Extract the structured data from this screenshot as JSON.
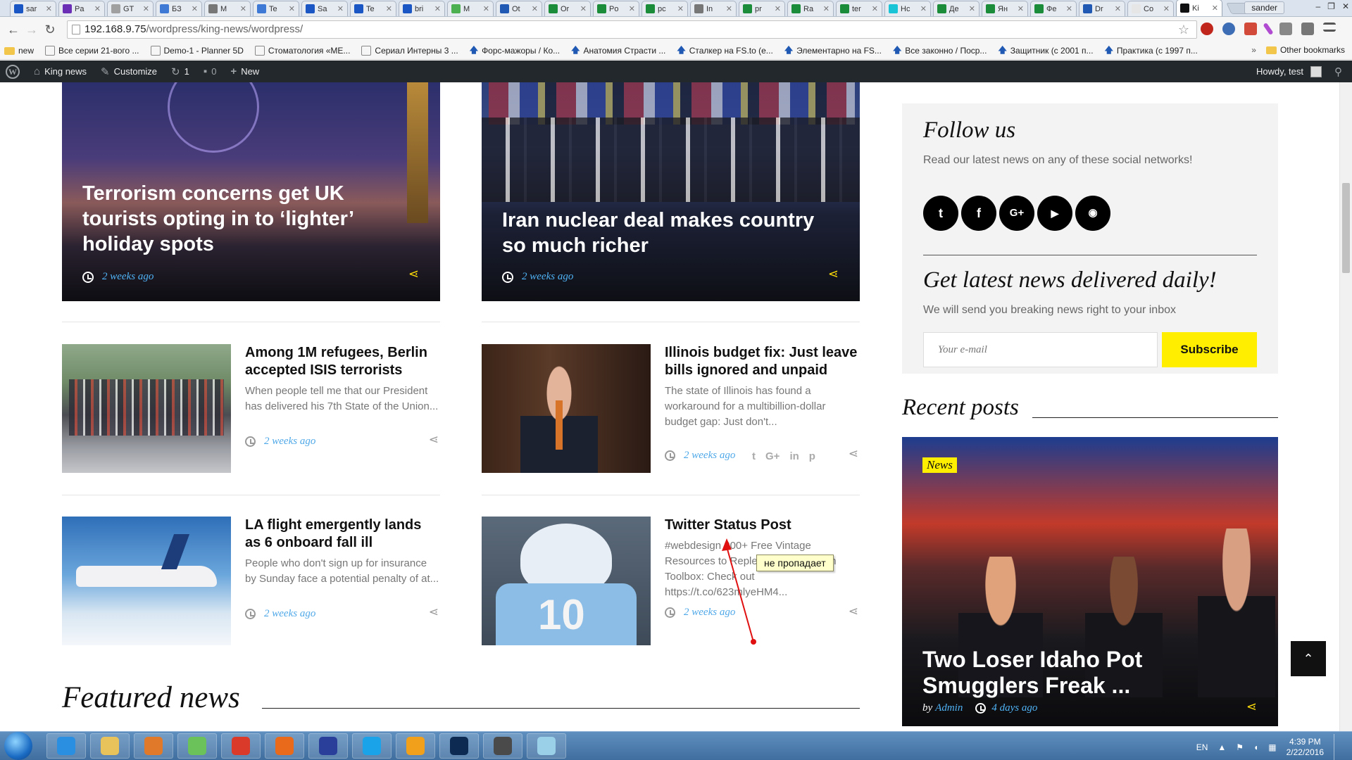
{
  "browser": {
    "tabs": [
      {
        "label": "sar",
        "color": "#1a56c4"
      },
      {
        "label": "Pa",
        "color": "#6b2fb5"
      },
      {
        "label": "GT",
        "color": "#a0a0a0"
      },
      {
        "label": "БЗ",
        "color": "#3e79d6"
      },
      {
        "label": "M",
        "color": "#777777"
      },
      {
        "label": "Te",
        "color": "#3e79d6"
      },
      {
        "label": "Sa",
        "color": "#1a56c4"
      },
      {
        "label": "Te",
        "color": "#1a56c4"
      },
      {
        "label": "bri",
        "color": "#1a56c4"
      },
      {
        "label": "M",
        "color": "#4caf50"
      },
      {
        "label": "Ot",
        "color": "#1f59b3"
      },
      {
        "label": "Or",
        "color": "#1a8c3a"
      },
      {
        "label": "Po",
        "color": "#1a8c3a"
      },
      {
        "label": "pc",
        "color": "#1a8c3a"
      },
      {
        "label": "In",
        "color": "#777777"
      },
      {
        "label": "pr",
        "color": "#1a8c3a"
      },
      {
        "label": "Ra",
        "color": "#1a8c3a"
      },
      {
        "label": "ter",
        "color": "#1a8c3a"
      },
      {
        "label": "Hc",
        "color": "#18c4d6"
      },
      {
        "label": "Де",
        "color": "#1a8c3a"
      },
      {
        "label": "Ян",
        "color": "#1a8c3a"
      },
      {
        "label": "Фе",
        "color": "#1a8c3a"
      },
      {
        "label": "Dr",
        "color": "#1f59b3"
      },
      {
        "label": "Co",
        "color": "#e6e6e6"
      },
      {
        "label": "Ki",
        "color": "#111111",
        "active": true
      }
    ],
    "profile": "sander",
    "window_controls": [
      "–",
      "❐",
      "✕"
    ],
    "url_host": "192.168.9.75",
    "url_path": "/wordpress/king-news/wordpress/",
    "bookmarks": [
      {
        "label": "new",
        "kind": "folder"
      },
      {
        "label": "Все серии 21-вого ...",
        "kind": "page"
      },
      {
        "label": "Demo-1 - Planner 5D",
        "kind": "page"
      },
      {
        "label": "Стоматология «МЕ...",
        "kind": "page"
      },
      {
        "label": "Сериал Интерны 3 ...",
        "kind": "page"
      },
      {
        "label": "Форс-мажоры / Ко...",
        "kind": "arrow"
      },
      {
        "label": "Анатомия Страсти ...",
        "kind": "arrow"
      },
      {
        "label": "Сталкер на FS.to (е...",
        "kind": "arrow"
      },
      {
        "label": "Элементарно на FS...",
        "kind": "arrow"
      },
      {
        "label": "Все законно / Поср...",
        "kind": "arrow"
      },
      {
        "label": "Защитник (с 2001 п...",
        "kind": "arrow"
      },
      {
        "label": "Практика (с 1997 п...",
        "kind": "arrow"
      }
    ],
    "other_bookmarks": "Other bookmarks"
  },
  "adminbar": {
    "wp_logo": "W",
    "site_name": "King news",
    "customize": "Customize",
    "updates": "1",
    "comments": "0",
    "new": "New",
    "howdy": "Howdy, test"
  },
  "heroes": [
    {
      "title": "Terrorism concerns get UK tourists opting in to ‘lighter’ holiday spots",
      "date": "2 weeks ago"
    },
    {
      "title": "Iran nuclear deal makes country so much richer",
      "date": "2 weeks ago"
    }
  ],
  "cards": [
    {
      "title": "Among 1M refugees, Berlin accepted ISIS terrorists",
      "excerpt": "When people tell me that our President has delivered his 7th State of the Union...",
      "date": "2 weeks ago"
    },
    {
      "title": "Illinois budget fix: Just leave bills ignored and unpaid",
      "excerpt": "The state of Illinois has found a workaround for a multibillion-dollar budget gap: Just don't...",
      "date": "2 weeks ago"
    },
    {
      "title": "LA flight emergently lands as 6 onboard fall ill",
      "excerpt": "People who don't sign up for insurance by Sunday face a potential penalty of at...",
      "date": "2 weeks ago"
    },
    {
      "title": "Twitter Status Post",
      "excerpt": "#webdesign 200+ Free Vintage Resources to Replenish your Design Toolbox: Check out https://t.co/623mlyeHM4...",
      "date": "2 weeks ago"
    }
  ],
  "share_icons": [
    "t",
    "G+",
    "in",
    "p"
  ],
  "featured_title": "Featured news",
  "sidebar": {
    "follow_title": "Follow us",
    "follow_desc": "Read our latest news on any of these social networks!",
    "socials": [
      {
        "name": "twitter-icon",
        "glyph": "t"
      },
      {
        "name": "facebook-icon",
        "glyph": "f"
      },
      {
        "name": "google-plus-icon",
        "glyph": "G+"
      },
      {
        "name": "youtube-icon",
        "glyph": "▶"
      },
      {
        "name": "rss-icon",
        "glyph": "◉"
      }
    ],
    "newsletter_title": "Get latest news delivered daily!",
    "newsletter_desc": "We will send you breaking news right to your inbox",
    "email_placeholder": "Your e-mail",
    "subscribe_label": "Subscribe",
    "recent_title": "Recent posts",
    "recent_post": {
      "badge": "News",
      "title": "Two Loser Idaho Pot Smugglers Freak ...",
      "by": "by",
      "author": "Admin",
      "date": "4 days ago"
    }
  },
  "annotation": "не пропадает",
  "taskbar": {
    "lang": "EN",
    "time": "4:39 PM",
    "date": "2/22/2016",
    "apps": [
      {
        "name": "ie",
        "color": "#2a8fe0"
      },
      {
        "name": "explorer",
        "color": "#e8c25a"
      },
      {
        "name": "media-player",
        "color": "#e07a2a"
      },
      {
        "name": "gadget",
        "color": "#6cc25a"
      },
      {
        "name": "chrome",
        "color": "#d93a2a"
      },
      {
        "name": "firefox",
        "color": "#e86a1a"
      },
      {
        "name": "save-app",
        "color": "#2a3f9a"
      },
      {
        "name": "skype",
        "color": "#1aa3e8"
      },
      {
        "name": "sublime-ish",
        "color": "#f0a01a"
      },
      {
        "name": "photoshop",
        "color": "#0c2a52"
      },
      {
        "name": "sublime-text",
        "color": "#4a4a4a"
      },
      {
        "name": "misc-app",
        "color": "#9ad0e8"
      }
    ]
  },
  "colors": {
    "accent_yellow": "#ffee00",
    "link_blue": "#4fb3f6",
    "admin_bar": "#23282d"
  }
}
